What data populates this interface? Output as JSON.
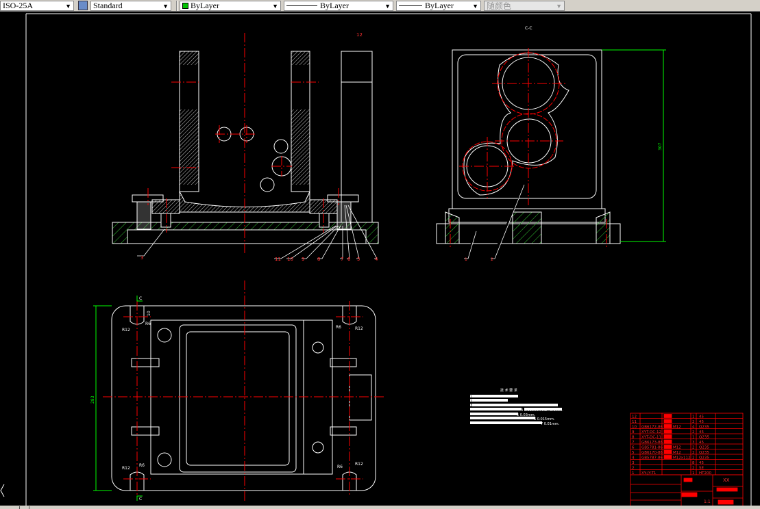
{
  "toolbar": {
    "dimstyle": "ISO-25A",
    "textstyle": "Standard",
    "layer": "ByLayer",
    "linetype": "ByLayer",
    "lineweight": "ByLayer",
    "color": "随颜色"
  },
  "colors": {
    "background": "#000000",
    "outline": "#ffffff",
    "centerline": "#ff0000",
    "dimension": "#00ff00",
    "hatch": "#33cc33"
  },
  "drawing": {
    "section_label": "C-C",
    "balloons_front": [
      "12",
      "3",
      "11",
      "10",
      "9",
      "8",
      "7",
      "6",
      "5",
      "4"
    ],
    "balloons_side": [
      "1",
      "2"
    ],
    "dim_side_height": "307",
    "dim_top_height": "283",
    "top_view": {
      "cut": "C",
      "radii": [
        "R12",
        "R6",
        "R6",
        "R12",
        "R6",
        "R12",
        "R6",
        "R12"
      ],
      "dim": "10"
    }
  },
  "tech": {
    "title": "技 术 要 求",
    "lines": [
      "1",
      "2",
      "3",
      "4 0.015mm 0.2~0.6mm.",
      "5 0.03mm.",
      "6 0.015mm.",
      "7 0.01mm."
    ]
  },
  "title_block": {
    "parts": [
      {
        "no": "12",
        "code": "",
        "qty": "1",
        "mat": "45"
      },
      {
        "no": "11",
        "code": "",
        "qty": "2",
        "mat": "45"
      },
      {
        "no": "10",
        "code": "GB6172-86",
        "spec": "M12",
        "qty": "4",
        "mat": "Q235"
      },
      {
        "no": "9",
        "code": "XYT-DC-12",
        "qty": "2",
        "mat": "45"
      },
      {
        "no": "8",
        "code": "XYT-DC-11",
        "qty": "1",
        "mat": "Q235"
      },
      {
        "no": "7",
        "code": "GB6173-86",
        "qty": "3",
        "mat": "45"
      },
      {
        "no": "6",
        "code": "GB5781-86",
        "spec": "M12",
        "qty": "2",
        "mat": "Q235"
      },
      {
        "no": "5",
        "code": "GB6170-86",
        "spec": "M12",
        "qty": "2",
        "mat": "Q235"
      },
      {
        "no": "4",
        "code": "GB5787-86",
        "spec": "M12x112",
        "qty": "2",
        "mat": "Q235"
      },
      {
        "no": "3",
        "code": "",
        "qty": "8",
        "mat": "45"
      },
      {
        "no": "2",
        "code": "",
        "qty": "2",
        "mat": "SE"
      },
      {
        "no": "1",
        "code": "XY-JY-T1",
        "qty": "1",
        "mat": "HT200"
      }
    ],
    "drawing_title": "XX",
    "scale": "1:1"
  }
}
